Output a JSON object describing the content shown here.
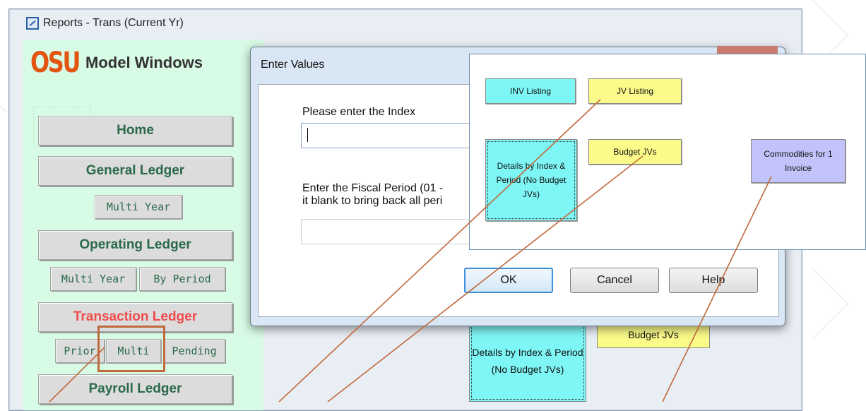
{
  "window": {
    "title": "Reports - Trans (Current Yr)"
  },
  "logo": {
    "mark": "OSU",
    "subtitle": "Model Windows"
  },
  "nav": {
    "home": "Home",
    "general_ledger": "General Ledger",
    "gl_multi_year": "Multi Year",
    "operating_ledger": "Operating Ledger",
    "ol_multi_year": "Multi Year",
    "ol_by_period": "By Period",
    "transaction_ledger": "Transaction Ledger",
    "tl_prior": "Prior",
    "tl_multi": "Multi",
    "tl_pending": "Pending",
    "payroll_ledger": "Payroll Ledger"
  },
  "dialog": {
    "title": "Enter Values",
    "prompt_index": "Please enter the Index",
    "index_value": "",
    "prompt_period": "Enter the Fiscal Period (01 -\nit blank to bring back all peri",
    "period_value": "",
    "ok": "OK",
    "cancel": "Cancel",
    "help": "Help"
  },
  "overlay": {
    "inv_listing": "INV Listing",
    "jv_listing": "JV Listing",
    "details": "Details by Index & Period (No Budget JVs)",
    "budget_jvs": "Budget JVs",
    "commodities": "Commodities for 1 Invoice"
  },
  "background_buttons": {
    "details": "Details by Index & Period (No Budget JVs)",
    "budget_jvs": "Budget JVs"
  },
  "colors": {
    "accent_red": "#ef4b4b",
    "nav_green": "#2b6a4a",
    "panel_green": "#d8fbe6",
    "cyan": "#7ff6f6",
    "yellow": "#fbfb8a",
    "lavender": "#c3c3fb",
    "callout_line": "#c0693a"
  }
}
